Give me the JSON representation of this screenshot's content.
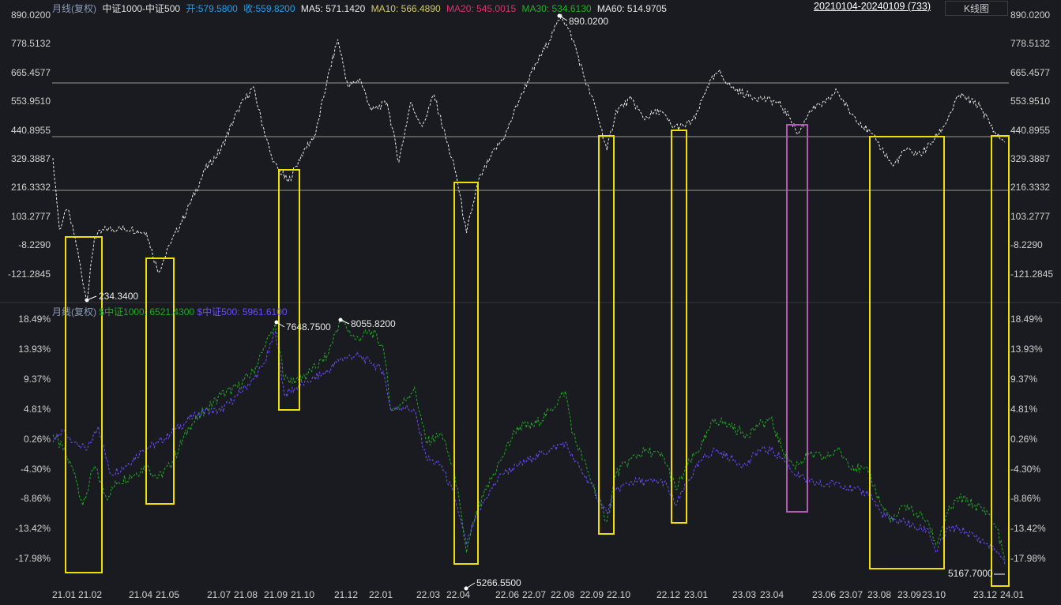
{
  "header": {
    "period": "月线(复权)",
    "symbol": "中证1000-中证500",
    "open": "开:579.5800",
    "close": "收:559.8200",
    "ma5": "MA5: 571.1420",
    "ma10": "MA10: 566.4890",
    "ma20": "MA20: 545.0015",
    "ma30": "MA30: 534.6130",
    "ma60": "MA60: 514.9705",
    "range": "20210104-20240109 (733)",
    "kline_button": "K线图"
  },
  "sub_header": {
    "period": "月线(复权)",
    "s1": "$中证1000: 6521.4300",
    "s2": "$中证500: 5961.6100"
  },
  "colors": {
    "bg": "#191b20",
    "open": "#1fa0f0",
    "ma10": "#d6c86a",
    "ma20": "#e0306a",
    "ma30": "#22b022",
    "s1": "#22a822",
    "s2": "#6a4cff",
    "box": "#f0e000",
    "box2": "#b05cb0"
  },
  "axes": {
    "top_ticks": [
      "890.0200",
      "778.5132",
      "665.4577",
      "553.9510",
      "440.8955",
      "329.3887",
      "216.3332",
      "103.2777",
      "-8.2290",
      "-121.2845"
    ],
    "bottom_ticks": [
      "18.49%",
      "13.93%",
      "9.37%",
      "4.81%",
      "0.26%",
      "-4.30%",
      "-8.86%",
      "-13.42%",
      "-17.98%"
    ],
    "x_labels": [
      "21.01",
      "21.02",
      "21.04",
      "21.05",
      "21.07",
      "21.08",
      "21.09",
      "21.10",
      "21.12",
      "22.01",
      "22.03",
      "22.04",
      "22.06",
      "22.07",
      "22.08",
      "22.09",
      "22.10",
      "22.12",
      "23.01",
      "23.03",
      "23.04",
      "23.06",
      "23.07",
      "23.08",
      "23.09",
      "23.10",
      "23.12",
      "24.01"
    ]
  },
  "annotations": {
    "spread_min": "234.3400",
    "spread_max": "890.0200",
    "s1_peak_a": "7648.7500",
    "s1_peak_b": "8055.8200",
    "s1_low": "5266.5500",
    "s1_end": "5167.7000"
  },
  "chart_data": [
    {
      "type": "line",
      "name": "中证1000-中证500",
      "ylim": [
        -121.2845,
        890.02
      ],
      "n": 733,
      "points": [
        [
          0,
          330
        ],
        [
          5,
          52
        ],
        [
          11,
          129
        ],
        [
          17,
          21
        ],
        [
          26,
          -234
        ],
        [
          32,
          21
        ],
        [
          41,
          52
        ],
        [
          50,
          52
        ],
        [
          60,
          52
        ],
        [
          72,
          36
        ],
        [
          81,
          -119
        ],
        [
          90,
          -10
        ],
        [
          105,
          145
        ],
        [
          117,
          284
        ],
        [
          129,
          361
        ],
        [
          142,
          516
        ],
        [
          154,
          609
        ],
        [
          160,
          485
        ],
        [
          169,
          315
        ],
        [
          181,
          237
        ],
        [
          193,
          361
        ],
        [
          202,
          423
        ],
        [
          211,
          639
        ],
        [
          219,
          794
        ],
        [
          227,
          609
        ],
        [
          236,
          639
        ],
        [
          245,
          516
        ],
        [
          257,
          547
        ],
        [
          266,
          315
        ],
        [
          275,
          547
        ],
        [
          284,
          454
        ],
        [
          293,
          578
        ],
        [
          303,
          392
        ],
        [
          310,
          268
        ],
        [
          318,
          36
        ],
        [
          327,
          237
        ],
        [
          336,
          330
        ],
        [
          348,
          423
        ],
        [
          360,
          578
        ],
        [
          372,
          701
        ],
        [
          385,
          825
        ],
        [
          391,
          890
        ],
        [
          400,
          794
        ],
        [
          409,
          639
        ],
        [
          418,
          516
        ],
        [
          426,
          361
        ],
        [
          433,
          516
        ],
        [
          445,
          562
        ],
        [
          454,
          485
        ],
        [
          467,
          516
        ],
        [
          476,
          454
        ],
        [
          485,
          454
        ],
        [
          494,
          485
        ],
        [
          503,
          609
        ],
        [
          512,
          670
        ],
        [
          521,
          609
        ],
        [
          533,
          578
        ],
        [
          546,
          562
        ],
        [
          558,
          547
        ],
        [
          567,
          485
        ],
        [
          573,
          423
        ],
        [
          582,
          516
        ],
        [
          594,
          547
        ],
        [
          603,
          593
        ],
        [
          612,
          516
        ],
        [
          621,
          469
        ],
        [
          634,
          392
        ],
        [
          646,
          299
        ],
        [
          655,
          361
        ],
        [
          667,
          345
        ],
        [
          676,
          392
        ],
        [
          685,
          454
        ],
        [
          697,
          578
        ],
        [
          713,
          531
        ],
        [
          725,
          423
        ],
        [
          732,
          392
        ]
      ]
    },
    {
      "type": "line",
      "name": "$中证1000",
      "unit": "%",
      "ylim": [
        -17.98,
        18.49
      ],
      "points": [
        [
          0,
          0.9
        ],
        [
          8,
          -1.5
        ],
        [
          17,
          -5.1
        ],
        [
          23,
          -9.9
        ],
        [
          32,
          -3.9
        ],
        [
          41,
          -8.7
        ],
        [
          50,
          -6.3
        ],
        [
          63,
          -5.1
        ],
        [
          72,
          -3.9
        ],
        [
          81,
          -5.7
        ],
        [
          90,
          -3.9
        ],
        [
          105,
          2.1
        ],
        [
          117,
          4.5
        ],
        [
          129,
          6.9
        ],
        [
          142,
          8.1
        ],
        [
          154,
          10.5
        ],
        [
          163,
          14.2
        ],
        [
          171,
          17.8
        ],
        [
          178,
          9.3
        ],
        [
          187,
          9.3
        ],
        [
          199,
          10.5
        ],
        [
          211,
          13.0
        ],
        [
          221,
          18.4
        ],
        [
          233,
          15.4
        ],
        [
          245,
          16.6
        ],
        [
          254,
          14.2
        ],
        [
          260,
          4.5
        ],
        [
          269,
          5.7
        ],
        [
          278,
          8.1
        ],
        [
          287,
          -0.3
        ],
        [
          299,
          0.9
        ],
        [
          309,
          -5.1
        ],
        [
          318,
          -17.1
        ],
        [
          324,
          -12.3
        ],
        [
          333,
          -7.5
        ],
        [
          345,
          -2.7
        ],
        [
          357,
          2.1
        ],
        [
          369,
          2.1
        ],
        [
          382,
          4.5
        ],
        [
          394,
          7.5
        ],
        [
          400,
          0.9
        ],
        [
          412,
          -5.1
        ],
        [
          426,
          -12.3
        ],
        [
          433,
          -5.1
        ],
        [
          445,
          -2.7
        ],
        [
          457,
          -1.5
        ],
        [
          470,
          -2.7
        ],
        [
          479,
          -7.5
        ],
        [
          488,
          -3.9
        ],
        [
          500,
          -0.3
        ],
        [
          509,
          3.3
        ],
        [
          521,
          2.1
        ],
        [
          533,
          0.9
        ],
        [
          542,
          2.1
        ],
        [
          552,
          3.3
        ],
        [
          561,
          -1.5
        ],
        [
          570,
          -3.9
        ],
        [
          582,
          -2.1
        ],
        [
          594,
          -2.7
        ],
        [
          603,
          -1.5
        ],
        [
          615,
          -3.9
        ],
        [
          628,
          -5.1
        ],
        [
          637,
          -9.9
        ],
        [
          646,
          -12.3
        ],
        [
          655,
          -9.9
        ],
        [
          664,
          -11.1
        ],
        [
          673,
          -12.3
        ],
        [
          679,
          -15.9
        ],
        [
          688,
          -11.1
        ],
        [
          697,
          -8.7
        ],
        [
          709,
          -9.9
        ],
        [
          719,
          -11.1
        ],
        [
          726,
          -13.5
        ],
        [
          732,
          -18.3
        ]
      ]
    },
    {
      "type": "line",
      "name": "$中证500",
      "unit": "%",
      "ylim": [
        -17.98,
        18.49
      ],
      "points": [
        [
          0,
          -0.3
        ],
        [
          8,
          1.5
        ],
        [
          17,
          -0.3
        ],
        [
          26,
          -1.5
        ],
        [
          35,
          2.1
        ],
        [
          44,
          -5.1
        ],
        [
          56,
          -3.9
        ],
        [
          69,
          -1.5
        ],
        [
          81,
          -0.3
        ],
        [
          90,
          0.9
        ],
        [
          105,
          3.3
        ],
        [
          117,
          4.5
        ],
        [
          129,
          4.5
        ],
        [
          142,
          6.9
        ],
        [
          154,
          9.3
        ],
        [
          163,
          11.8
        ],
        [
          171,
          16.6
        ],
        [
          178,
          6.9
        ],
        [
          187,
          8.1
        ],
        [
          199,
          9.3
        ],
        [
          211,
          10.5
        ],
        [
          221,
          12.4
        ],
        [
          233,
          13.0
        ],
        [
          245,
          11.8
        ],
        [
          254,
          10.5
        ],
        [
          260,
          4.5
        ],
        [
          269,
          5.1
        ],
        [
          278,
          4.5
        ],
        [
          287,
          -2.7
        ],
        [
          299,
          -3.9
        ],
        [
          309,
          -8.7
        ],
        [
          318,
          -15.9
        ],
        [
          324,
          -12.3
        ],
        [
          333,
          -8.7
        ],
        [
          345,
          -5.1
        ],
        [
          357,
          -3.9
        ],
        [
          369,
          -2.7
        ],
        [
          382,
          -1.5
        ],
        [
          394,
          -0.3
        ],
        [
          400,
          -2.7
        ],
        [
          412,
          -6.3
        ],
        [
          426,
          -11.1
        ],
        [
          433,
          -7.5
        ],
        [
          445,
          -6.3
        ],
        [
          457,
          -6.3
        ],
        [
          470,
          -6.3
        ],
        [
          479,
          -9.9
        ],
        [
          488,
          -6.3
        ],
        [
          500,
          -2.7
        ],
        [
          509,
          -1.5
        ],
        [
          521,
          -2.7
        ],
        [
          533,
          -3.9
        ],
        [
          542,
          -1.5
        ],
        [
          552,
          -1.5
        ],
        [
          561,
          -2.7
        ],
        [
          570,
          -5.1
        ],
        [
          582,
          -6.3
        ],
        [
          594,
          -6.9
        ],
        [
          603,
          -6.3
        ],
        [
          615,
          -7.5
        ],
        [
          628,
          -8.1
        ],
        [
          637,
          -11.1
        ],
        [
          646,
          -12.3
        ],
        [
          655,
          -12.3
        ],
        [
          664,
          -13.5
        ],
        [
          673,
          -13.5
        ],
        [
          679,
          -17.1
        ],
        [
          688,
          -13.5
        ],
        [
          697,
          -13.5
        ],
        [
          709,
          -14.7
        ],
        [
          719,
          -15.9
        ],
        [
          726,
          -17.1
        ],
        [
          732,
          -18.9
        ]
      ]
    }
  ]
}
